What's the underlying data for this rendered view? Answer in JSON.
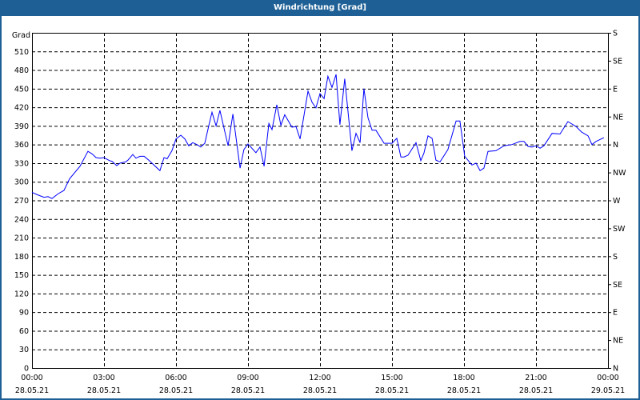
{
  "window": {
    "title": "Windrichtung [Grad]"
  },
  "colors": {
    "titlebar": "#1e6096",
    "line": "#0000ff",
    "grid": "#000000"
  },
  "chart_data": {
    "type": "line",
    "title": "Windrichtung [Grad]",
    "ylabel": "Grad",
    "xlabel": "",
    "ylim": [
      0,
      540
    ],
    "xlim_hours": [
      0,
      24
    ],
    "grid": true,
    "y_ticks": [
      0,
      30,
      60,
      90,
      120,
      150,
      180,
      210,
      240,
      270,
      300,
      330,
      360,
      390,
      420,
      450,
      480,
      510
    ],
    "x_ticks": [
      {
        "time": "00:00",
        "date": "28.05.21"
      },
      {
        "time": "03:00",
        "date": "28.05.21"
      },
      {
        "time": "06:00",
        "date": "28.05.21"
      },
      {
        "time": "09:00",
        "date": "28.05.21"
      },
      {
        "time": "12:00",
        "date": "28.05.21"
      },
      {
        "time": "15:00",
        "date": "28.05.21"
      },
      {
        "time": "18:00",
        "date": "28.05.21"
      },
      {
        "time": "21:00",
        "date": "28.05.21"
      },
      {
        "time": "00:00",
        "date": "29.05.21"
      }
    ],
    "right_axis": [
      {
        "value": 540,
        "label": "S"
      },
      {
        "value": 495,
        "label": "SE"
      },
      {
        "value": 450,
        "label": "E"
      },
      {
        "value": 405,
        "label": "NE"
      },
      {
        "value": 360,
        "label": "N"
      },
      {
        "value": 315,
        "label": "NW"
      },
      {
        "value": 270,
        "label": "W"
      },
      {
        "value": 225,
        "label": "SW"
      },
      {
        "value": 180,
        "label": "S"
      },
      {
        "value": 135,
        "label": "SE"
      },
      {
        "value": 90,
        "label": "E"
      },
      {
        "value": 45,
        "label": "NE"
      },
      {
        "value": 0,
        "label": "N"
      }
    ],
    "series": [
      {
        "name": "Windrichtung",
        "points": [
          [
            0,
            283
          ],
          [
            0.23,
            279
          ],
          [
            0.5,
            275
          ],
          [
            0.67,
            276
          ],
          [
            0.83,
            273
          ],
          [
            1.1,
            281
          ],
          [
            1.33,
            286
          ],
          [
            1.57,
            305
          ],
          [
            2,
            325
          ],
          [
            2.33,
            349
          ],
          [
            2.5,
            345
          ],
          [
            2.67,
            339
          ],
          [
            2.83,
            338
          ],
          [
            3,
            339
          ],
          [
            3.23,
            334
          ],
          [
            3.33,
            333
          ],
          [
            3.53,
            326
          ],
          [
            3.67,
            330
          ],
          [
            3.9,
            332
          ],
          [
            4,
            335
          ],
          [
            4.2,
            344
          ],
          [
            4.33,
            338
          ],
          [
            4.5,
            341
          ],
          [
            4.67,
            341
          ],
          [
            4.83,
            336
          ],
          [
            5.33,
            318
          ],
          [
            5.5,
            339
          ],
          [
            5.63,
            337
          ],
          [
            5.83,
            350
          ],
          [
            6,
            369
          ],
          [
            6.2,
            375
          ],
          [
            6.37,
            369
          ],
          [
            6.53,
            358
          ],
          [
            6.7,
            363
          ],
          [
            6.87,
            360
          ],
          [
            7.03,
            356
          ],
          [
            7.2,
            362
          ],
          [
            7.37,
            391
          ],
          [
            7.5,
            412
          ],
          [
            7.67,
            390
          ],
          [
            7.83,
            415
          ],
          [
            8.17,
            358
          ],
          [
            8.37,
            409
          ],
          [
            8.67,
            322
          ],
          [
            8.83,
            352
          ],
          [
            9,
            361
          ],
          [
            9.33,
            347
          ],
          [
            9.5,
            356
          ],
          [
            9.67,
            325
          ],
          [
            9.87,
            394
          ],
          [
            10,
            384
          ],
          [
            10.2,
            424
          ],
          [
            10.37,
            391
          ],
          [
            10.53,
            408
          ],
          [
            10.83,
            388
          ],
          [
            11,
            389
          ],
          [
            11.17,
            369
          ],
          [
            11.5,
            446
          ],
          [
            11.67,
            428
          ],
          [
            11.83,
            419
          ],
          [
            12,
            442
          ],
          [
            12.17,
            434
          ],
          [
            12.33,
            470
          ],
          [
            12.5,
            452
          ],
          [
            12.67,
            473
          ],
          [
            12.83,
            392
          ],
          [
            13.03,
            466
          ],
          [
            13.33,
            350
          ],
          [
            13.5,
            378
          ],
          [
            13.67,
            363
          ],
          [
            13.83,
            450
          ],
          [
            14,
            403
          ],
          [
            14.17,
            383
          ],
          [
            14.33,
            383
          ],
          [
            14.67,
            362
          ],
          [
            15,
            362
          ],
          [
            15.2,
            370
          ],
          [
            15.37,
            340
          ],
          [
            15.5,
            340
          ],
          [
            15.67,
            343
          ],
          [
            16,
            363
          ],
          [
            16.2,
            334
          ],
          [
            16.33,
            346
          ],
          [
            16.5,
            374
          ],
          [
            16.67,
            370
          ],
          [
            16.83,
            335
          ],
          [
            17,
            332
          ],
          [
            17.33,
            352
          ],
          [
            17.67,
            398
          ],
          [
            17.83,
            398
          ],
          [
            18.03,
            341
          ],
          [
            18.33,
            327
          ],
          [
            18.5,
            330
          ],
          [
            18.67,
            318
          ],
          [
            18.83,
            322
          ],
          [
            19,
            349
          ],
          [
            19.33,
            350
          ],
          [
            19.67,
            358
          ],
          [
            20,
            360
          ],
          [
            20.33,
            365
          ],
          [
            20.5,
            365
          ],
          [
            20.67,
            357
          ],
          [
            20.83,
            356
          ],
          [
            21,
            358
          ],
          [
            21.17,
            354
          ],
          [
            21.33,
            358
          ],
          [
            21.67,
            378
          ],
          [
            22,
            377
          ],
          [
            22.33,
            397
          ],
          [
            22.67,
            389
          ],
          [
            22.9,
            380
          ],
          [
            23.17,
            374
          ],
          [
            23.33,
            360
          ],
          [
            23.5,
            365
          ],
          [
            23.83,
            371
          ]
        ]
      }
    ]
  }
}
